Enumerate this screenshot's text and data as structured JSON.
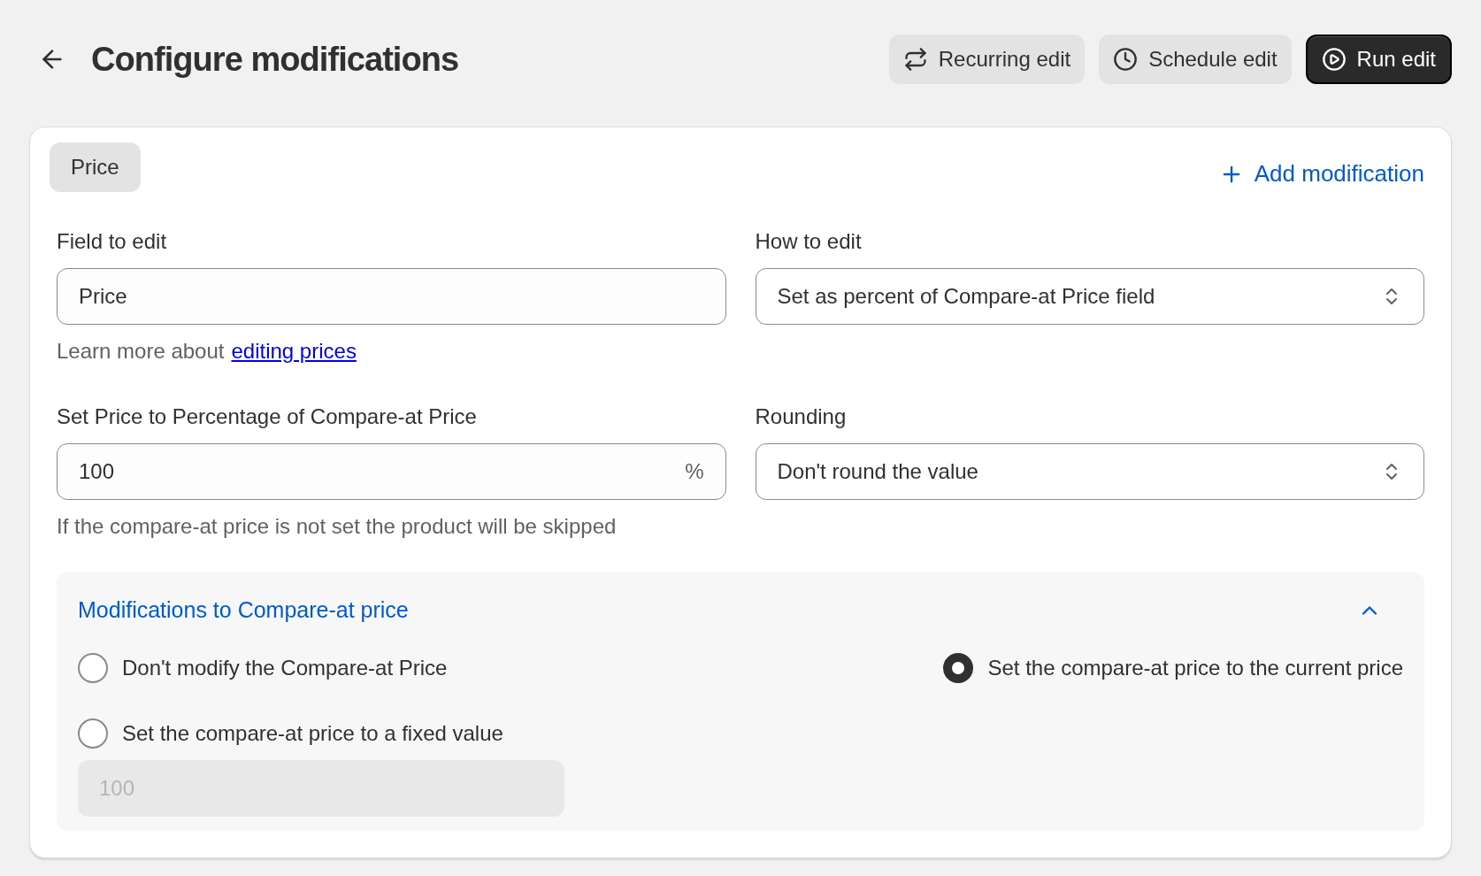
{
  "header": {
    "title": "Configure modifications",
    "buttons": [
      {
        "label": "Recurring edit",
        "kind": "secondary"
      },
      {
        "label": "Schedule edit",
        "kind": "secondary"
      },
      {
        "label": "Run edit",
        "kind": "primary"
      }
    ]
  },
  "card": {
    "tab": "Price",
    "add_link": "Add modification",
    "fields": [
      {
        "kind": "text",
        "label": "Field to edit",
        "value": "Price",
        "help": "Learn more about",
        "help_link": "editing prices"
      },
      {
        "kind": "select",
        "label": "How to edit",
        "value": "Set as percent of Compare-at Price field"
      },
      {
        "kind": "number",
        "label": "Set Price to Percentage of Compare-at Price",
        "value": "100",
        "suffix": "%",
        "help": "If the compare-at price is not set the product will be skipped"
      },
      {
        "kind": "select",
        "label": "Rounding",
        "value": "Don't round the value"
      }
    ],
    "section": {
      "title": "Modifications to Compare-at price",
      "expanded": true,
      "options": [
        {
          "label": "Don't modify the Compare-at Price",
          "selected": false
        },
        {
          "label": "Set the compare-at price to the current price",
          "selected": true
        },
        {
          "label": "Set the compare-at price to a fixed value",
          "selected": false
        }
      ],
      "fixed_value": {
        "value": "100",
        "disabled": true
      }
    }
  }
}
